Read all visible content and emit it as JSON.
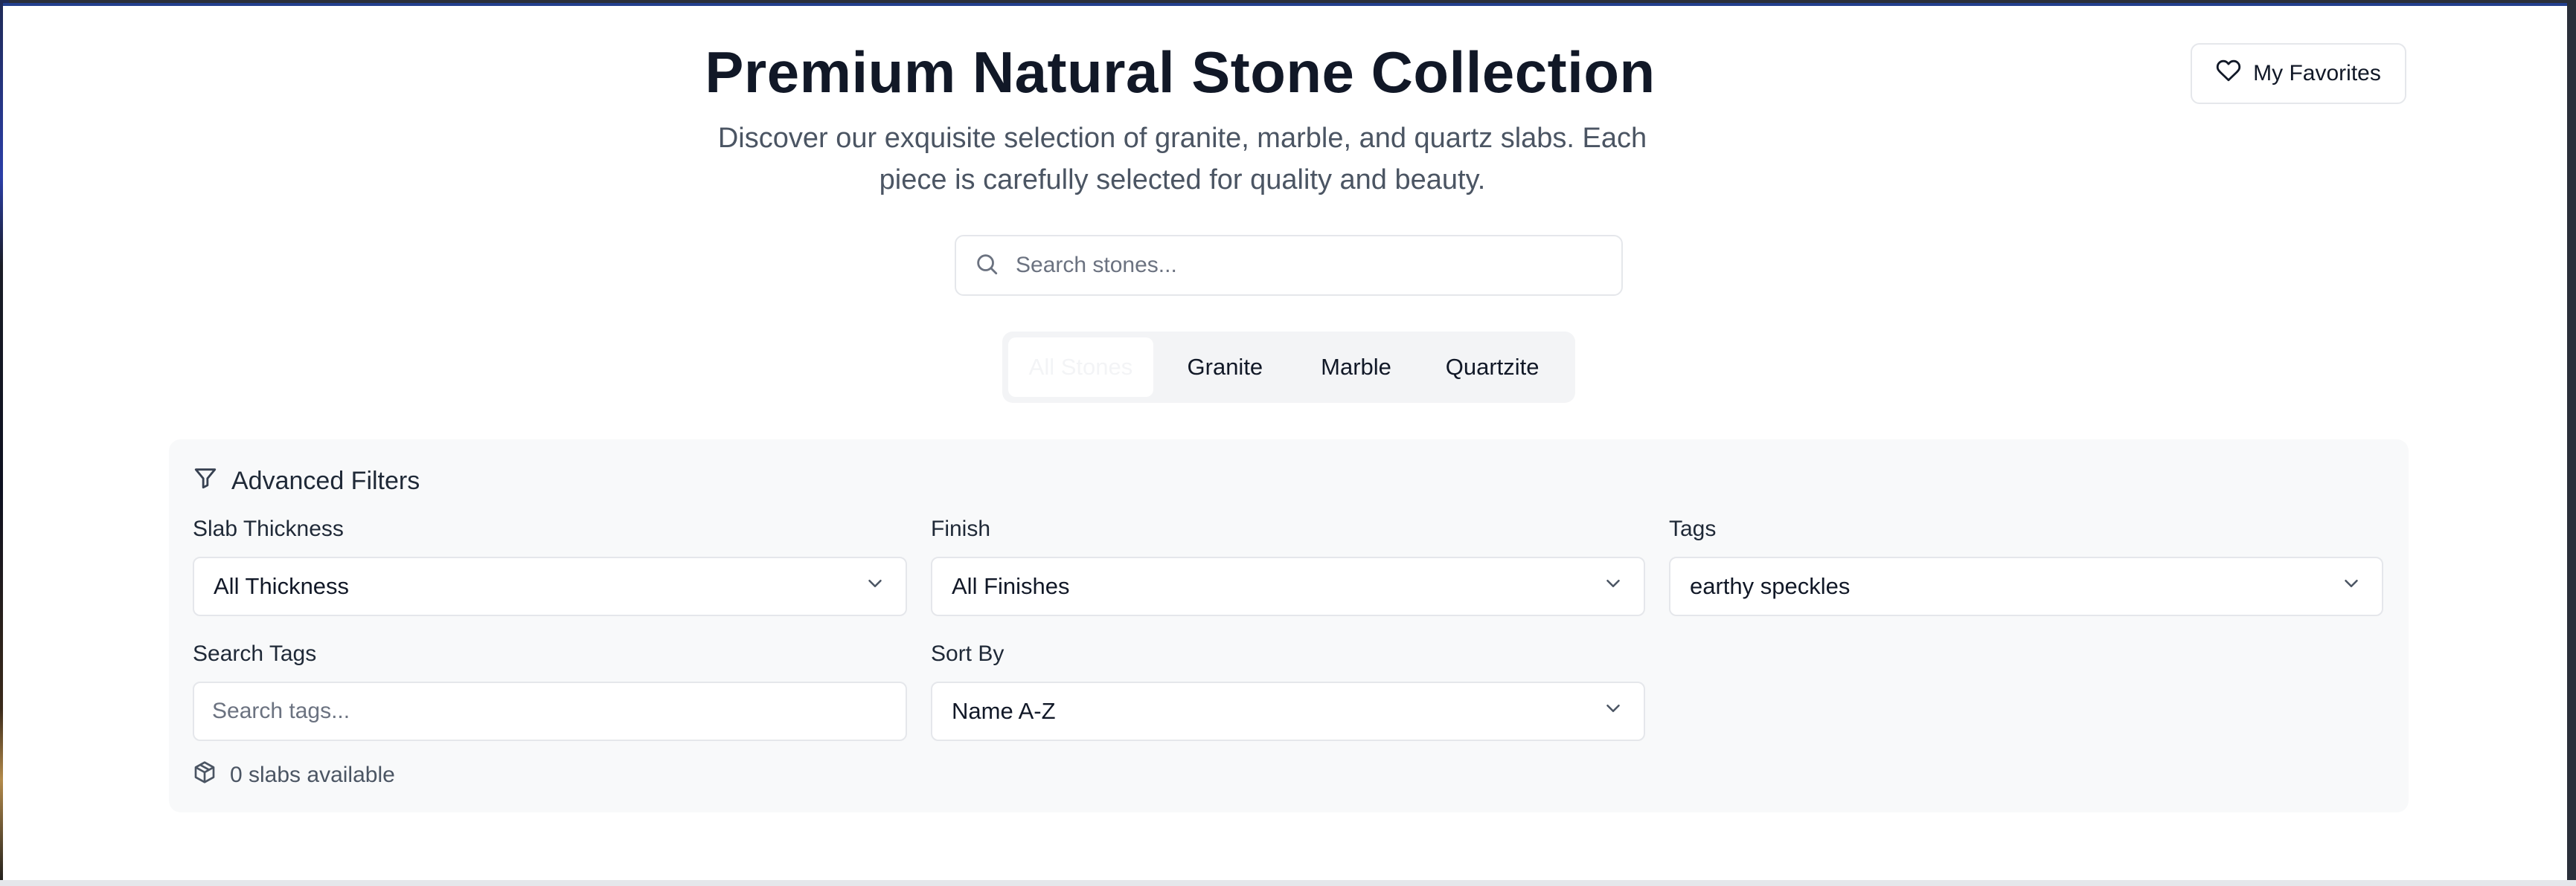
{
  "header": {
    "title": "Premium Natural Stone Collection",
    "subtitle": "Discover our exquisite selection of granite, marble, and quartz slabs. Each piece is carefully selected for quality and beauty.",
    "favorites_label": "My Favorites"
  },
  "search": {
    "placeholder": "Search stones...",
    "value": ""
  },
  "tabs": [
    {
      "label": "All Stones",
      "active": true
    },
    {
      "label": "Granite",
      "active": false
    },
    {
      "label": "Marble",
      "active": false
    },
    {
      "label": "Quartzite",
      "active": false
    }
  ],
  "filters": {
    "heading": "Advanced Filters",
    "thickness": {
      "label": "Slab Thickness",
      "value": "All Thickness"
    },
    "finish": {
      "label": "Finish",
      "value": "All Finishes"
    },
    "tags": {
      "label": "Tags",
      "value": "earthy speckles"
    },
    "search_tags": {
      "label": "Search Tags",
      "placeholder": "Search tags...",
      "value": ""
    },
    "sort": {
      "label": "Sort By",
      "value": "Name A-Z"
    },
    "availability": "0 slabs available"
  },
  "icons": {
    "favorites": "heart-icon",
    "search": "search-icon",
    "filter": "filter-icon",
    "chevron": "chevron-down-icon",
    "package": "package-icon"
  },
  "colors": {
    "accent_bar": "#23408e",
    "text_primary": "#111827",
    "text_muted": "#4b5563",
    "panel_bg": "#f8f9fa",
    "border": "#e5e7eb"
  }
}
